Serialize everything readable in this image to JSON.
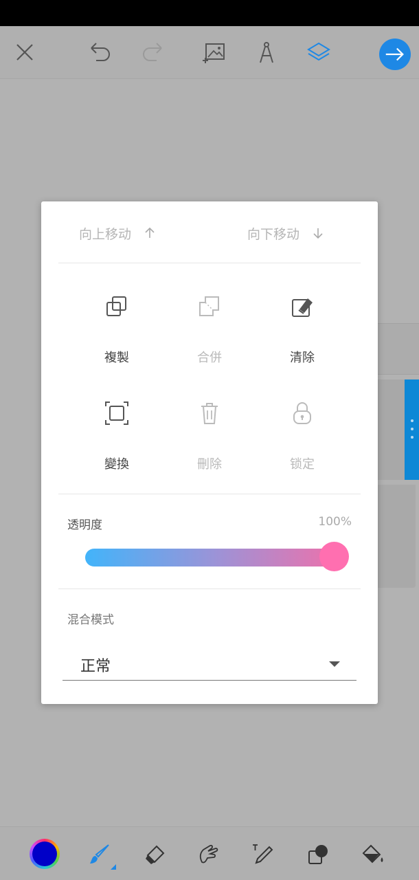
{
  "colors": {
    "accent": "#1e88e5",
    "toolbar_icon": "#555555",
    "current_color": "#0000c8",
    "slider_start": "#42b4fa",
    "slider_end": "#f26fa8",
    "slider_thumb": "#ff6fb0"
  },
  "top_toolbar": {
    "icons": [
      "close-icon",
      "undo-icon",
      "redo-icon",
      "add-image-icon",
      "compass-icon",
      "layers-icon",
      "arrow-right-icon"
    ]
  },
  "layer_menu": {
    "move_up_label": "向上移动",
    "move_down_label": "向下移动",
    "actions": [
      {
        "label": "複製",
        "icon": "duplicate-icon",
        "enabled": true
      },
      {
        "label": "合併",
        "icon": "merge-icon",
        "enabled": false
      },
      {
        "label": "清除",
        "icon": "clear-icon",
        "enabled": true
      },
      {
        "label": "變換",
        "icon": "transform-icon",
        "enabled": true
      },
      {
        "label": "刪除",
        "icon": "trash-icon",
        "enabled": false
      },
      {
        "label": "锁定",
        "icon": "lock-icon",
        "enabled": false
      }
    ],
    "opacity_label": "透明度",
    "opacity_value": "100%",
    "opacity_fraction": 1.0,
    "blend_mode_label": "混合模式",
    "blend_mode_value": "正常"
  },
  "bottom_toolbar": {
    "tools": [
      "color-picker",
      "brush-icon",
      "eraser-icon",
      "smudge-icon",
      "text-pen-icon",
      "shape-icon",
      "fill-bucket-icon"
    ],
    "active_tool": "brush-icon"
  }
}
